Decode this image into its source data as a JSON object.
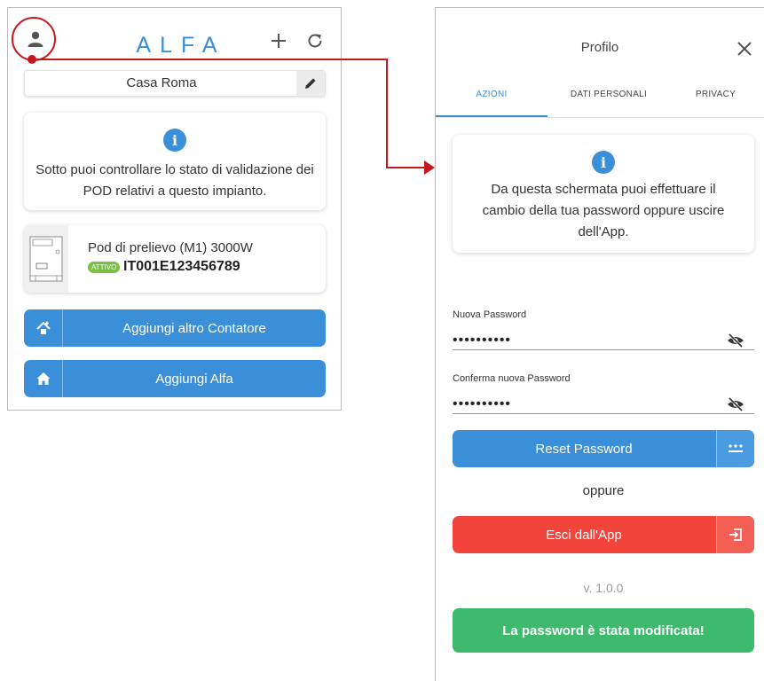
{
  "left_screen": {
    "logo_text": "ALFA",
    "location": {
      "name": "Casa Roma"
    },
    "info_card": {
      "text": "Sotto puoi controllare lo stato di validazione dei POD relativi a questo impianto."
    },
    "pod": {
      "title": "Pod di prelievo (M1) 3000W",
      "status_badge": "ATTIVO",
      "code": "IT001E123456789"
    },
    "buttons": {
      "add_meter": "Aggiungi altro Contatore",
      "add_alfa": "Aggiungi Alfa"
    }
  },
  "right_screen": {
    "title": "Profilo",
    "tabs": [
      {
        "label": "AZIONI"
      },
      {
        "label": "DATI PERSONALI"
      },
      {
        "label": "PRIVACY"
      }
    ],
    "info_card": {
      "text": "Da questa schermata puoi effettuare il cambio della tua password oppure uscire dell'App."
    },
    "new_password": {
      "label": "Nuova Password",
      "value": "••••••••••"
    },
    "confirm_password": {
      "label": "Conferma nuova Password",
      "value": "••••••••••"
    },
    "reset_button": "Reset Password",
    "or_text": "oppure",
    "logout_button": "Esci dall'App",
    "version": "v. 1.0.0",
    "toast": "La password è stata modificata!"
  },
  "colors": {
    "accent_blue": "#3a8fd8",
    "danger_red": "#f2443a",
    "success_green": "#3dba6b",
    "annotation_red": "#c8161d",
    "badge_green": "#7ac143"
  },
  "icons": [
    "user-icon",
    "plus-icon",
    "refresh-icon",
    "pencil-icon",
    "info-icon",
    "meter-icon",
    "house-add-icon",
    "home-icon",
    "close-icon",
    "eye-off-icon",
    "keypad-icon",
    "logout-icon"
  ]
}
